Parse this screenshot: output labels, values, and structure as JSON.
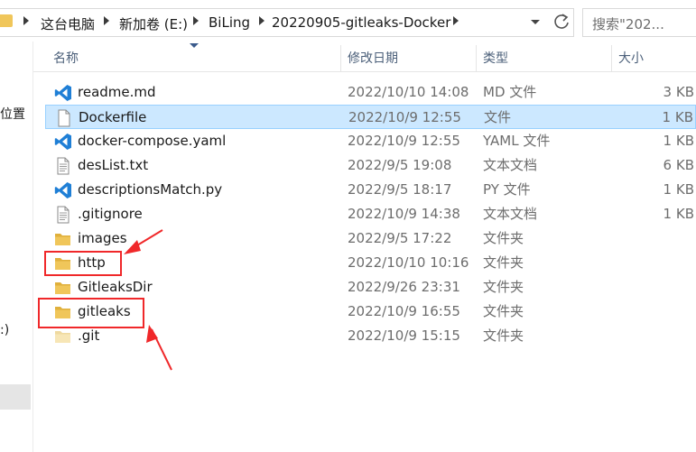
{
  "address": {
    "crumbs": [
      "这台电脑",
      "新加卷 (E:)",
      "BiLing",
      "20220905-gitleaks-Docker"
    ]
  },
  "search": {
    "placeholder": "搜索\"202..."
  },
  "nav": {
    "quick_label": "位置",
    "drive_label": ":)"
  },
  "columns": {
    "name": "名称",
    "date": "修改日期",
    "type": "类型",
    "size": "大小"
  },
  "files": [
    {
      "name": "readme.md",
      "date": "2022/10/10 14:08",
      "type": "MD 文件",
      "size": "3 KB",
      "icon": "vscode-icon",
      "selected": false
    },
    {
      "name": "Dockerfile",
      "date": "2022/10/9 12:55",
      "type": "文件",
      "size": "1 KB",
      "icon": "blank-file-icon",
      "selected": true
    },
    {
      "name": "docker-compose.yaml",
      "date": "2022/10/9 12:55",
      "type": "YAML 文件",
      "size": "1 KB",
      "icon": "vscode-icon",
      "selected": false
    },
    {
      "name": "desList.txt",
      "date": "2022/9/5 19:08",
      "type": "文本文档",
      "size": "6 KB",
      "icon": "text-file-icon",
      "selected": false
    },
    {
      "name": "descriptionsMatch.py",
      "date": "2022/9/5 18:17",
      "type": "PY 文件",
      "size": "1 KB",
      "icon": "vscode-icon",
      "selected": false
    },
    {
      "name": ".gitignore",
      "date": "2022/10/9 14:38",
      "type": "文本文档",
      "size": "1 KB",
      "icon": "text-file-icon",
      "selected": false
    },
    {
      "name": "images",
      "date": "2022/9/5 17:22",
      "type": "文件夹",
      "size": "",
      "icon": "folder-icon",
      "selected": false
    },
    {
      "name": "http",
      "date": "2022/10/10 10:16",
      "type": "文件夹",
      "size": "",
      "icon": "folder-icon",
      "selected": false
    },
    {
      "name": "GitleaksDir",
      "date": "2022/9/26 23:31",
      "type": "文件夹",
      "size": "",
      "icon": "folder-icon",
      "selected": false
    },
    {
      "name": "gitleaks",
      "date": "2022/10/9 16:55",
      "type": "文件夹",
      "size": "",
      "icon": "folder-icon",
      "selected": false
    },
    {
      "name": ".git",
      "date": "2022/10/9 15:15",
      "type": "文件夹",
      "size": "",
      "icon": "folder-light-icon",
      "selected": false
    }
  ],
  "colors": {
    "selection_bg": "#cce8ff",
    "selection_border": "#99d1ff",
    "annotation": "#f0282a",
    "vscode_blue": "#1f7fd6",
    "folder_yellow": "#f0c65a"
  }
}
